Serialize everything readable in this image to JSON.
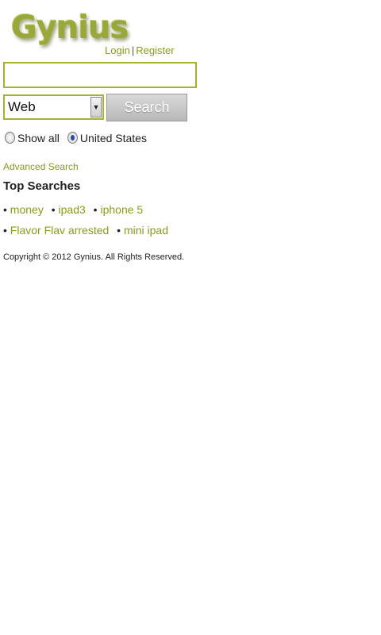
{
  "header": {
    "logo_text": "Gynius",
    "login_label": "Login",
    "separator": "|",
    "register_label": "Register"
  },
  "search": {
    "query_value": "",
    "scope_selected": "Web",
    "button_label": "Search"
  },
  "filters": {
    "show_all_label": "Show all",
    "region_label": "United States",
    "selected": "United States"
  },
  "advanced_link": "Advanced Search",
  "top_searches": {
    "title": "Top Searches",
    "bullet": "•",
    "items": [
      "money",
      "ipad3",
      "iphone 5",
      "Flavor Flav arrested",
      "mini ipad"
    ]
  },
  "footer": {
    "copyright": "Copyright © 2012 Gynius. All Rights Reserved."
  },
  "colors": {
    "accent": "#8b9a1d",
    "border": "#a3b232"
  }
}
